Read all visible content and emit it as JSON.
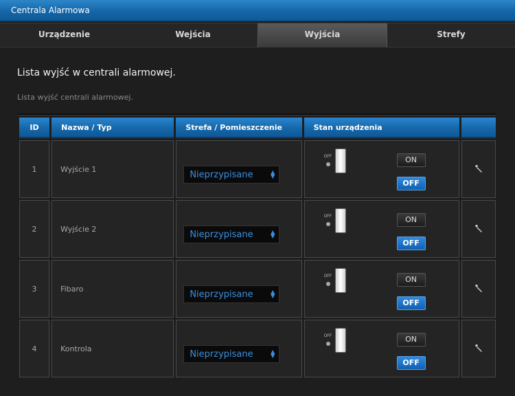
{
  "window": {
    "title": "Centrala Alarmowa"
  },
  "tabs": [
    {
      "label": "Urządzenie",
      "active": false
    },
    {
      "label": "Wejścia",
      "active": false
    },
    {
      "label": "Wyjścia",
      "active": true
    },
    {
      "label": "Strefy",
      "active": false
    }
  ],
  "page": {
    "heading": "Lista wyjść w centrali alarmowej.",
    "subheading": "Lista wyjść centrali alarmowej."
  },
  "table": {
    "headers": {
      "id": "ID",
      "name": "Nazwa / Typ",
      "zone": "Strefa / Pomieszczenie",
      "state": "Stan urządzenia",
      "actions": ""
    },
    "rows": [
      {
        "id": "1",
        "name": "Wyjście 1",
        "zone": "Nieprzypisane",
        "switch_label": "OFF",
        "on_label": "ON",
        "off_label": "OFF",
        "action_icon": "wrench-icon"
      },
      {
        "id": "2",
        "name": "Wyjście 2",
        "zone": "Nieprzypisane",
        "switch_label": "OFF",
        "on_label": "ON",
        "off_label": "OFF",
        "action_icon": "wrench-icon"
      },
      {
        "id": "3",
        "name": "Fibaro",
        "zone": "Nieprzypisane",
        "switch_label": "OFF",
        "on_label": "ON",
        "off_label": "OFF",
        "action_icon": "wrench-icon"
      },
      {
        "id": "4",
        "name": "Kontrola",
        "zone": "Nieprzypisane",
        "switch_label": "OFF",
        "on_label": "ON",
        "off_label": "OFF",
        "action_icon": "wrench-icon"
      }
    ]
  },
  "colors": {
    "accent_blue": "#1a6fb8",
    "select_text": "#3a8ee0",
    "background": "#1e1e1e"
  }
}
